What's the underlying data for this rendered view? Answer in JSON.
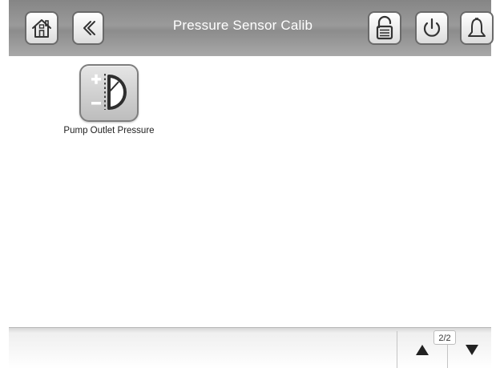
{
  "header": {
    "title": "Pressure Sensor Calib",
    "buttons": {
      "home": {
        "icon": "home-icon"
      },
      "back": {
        "icon": "chevron-double-left-icon"
      },
      "lock": {
        "icon": "unlocked-padlock-icon"
      },
      "power": {
        "icon": "power-icon"
      },
      "alarm": {
        "icon": "bell-icon"
      }
    }
  },
  "main": {
    "items": [
      {
        "label": "Pump Outlet Pressure",
        "icon": "pressure-calibration-gauge-icon"
      }
    ]
  },
  "footer": {
    "page_indicator": "2/2",
    "page_up_icon": "triangle-up-icon",
    "page_down_icon": "triangle-down-icon"
  },
  "colors": {
    "header_background": "#9a9a9a",
    "header_text": "#ffffff",
    "button_border": "#6a6a6a",
    "content_background": "#ffffff"
  }
}
